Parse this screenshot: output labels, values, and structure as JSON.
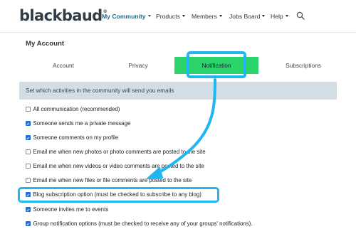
{
  "brand": {
    "name": "blackbaud",
    "reg": "®"
  },
  "nav": {
    "items": [
      {
        "label": "My Community",
        "active": true
      },
      {
        "label": "Products",
        "active": false
      },
      {
        "label": "Members",
        "active": false
      },
      {
        "label": "Jobs Board",
        "active": false
      },
      {
        "label": "Help",
        "active": false
      }
    ],
    "search_icon": "search-icon"
  },
  "page": {
    "title": "My Account"
  },
  "tabs": [
    {
      "label": "Account",
      "active": false
    },
    {
      "label": "Privacy",
      "active": false
    },
    {
      "label": "Notification",
      "active": true
    },
    {
      "label": "Subscriptions",
      "active": false
    }
  ],
  "banner": "Set which activities in the community will send you emails",
  "options": [
    {
      "label": "All communication (recommended)",
      "checked": false
    },
    {
      "label": "Someone sends me a private message",
      "checked": true
    },
    {
      "label": "Someone comments on my profile",
      "checked": true
    },
    {
      "label": "Email me when new photos or photo comments are posted to the site",
      "checked": false
    },
    {
      "label": "Email me when new videos or video comments are posted to the site",
      "checked": false
    },
    {
      "label": "Email me when new files or file comments are posted to the site",
      "checked": false
    },
    {
      "label": "Blog subscription option (must be checked to subscribe to any blog)",
      "checked": true
    },
    {
      "label": "Someone invites me to events",
      "checked": true
    },
    {
      "label": "Group notification options (must be checked to receive any of your groups' notifications).",
      "checked": true
    }
  ],
  "colors": {
    "active_tab": "#2bd46a",
    "highlight": "#22b6f0",
    "checkbox": "#1f6fd9",
    "banner": "#d3dee4",
    "brand": "#2f3c46",
    "nav_active": "#1b6f8a"
  }
}
